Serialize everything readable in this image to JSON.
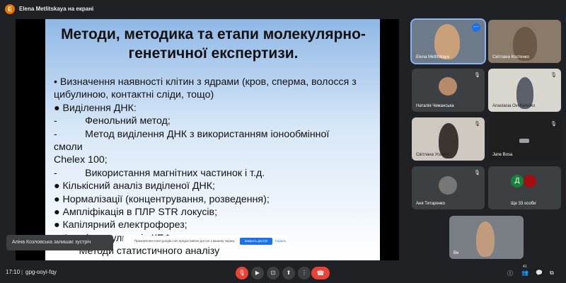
{
  "top_bar": {
    "presenter_initial": "E",
    "presenter_label": "Elena Metlitskaya на екрані"
  },
  "slide": {
    "title_lines": [
      "Методи, методика та етапи молекулярно-",
      "генетичної експертизи."
    ],
    "body_lines": [
      "• Визначення наявності клітин з ядрами (кров, сперма, волосся з",
      "цибулиною, контактні сліди, тощо)",
      "● Виділення ДНК:",
      "-          Фенольний метод;",
      "-          Метод виділення ДНК з використанням іонообмінної",
      "смоли",
      "Chelex 100;",
      "-          Використання магнітних частинок і т.д.",
      "●  Кількісний аналіз виділеної ДНК;",
      "● Нормалізації (концентрування, розведення);",
      "● Ампліфікація в ПЛР STR локусів;",
      "● Капілярний електрофорез;",
      "● Аналіз результатів КЕФа",
      "         Методи статистичного аналізу"
    ]
  },
  "participants": [
    {
      "name": "Elena Metlitskaya"
    },
    {
      "name": "Світлана Костенко"
    },
    {
      "name": "Наталія Чижанська"
    },
    {
      "name": "Anastasia Ovcharenko"
    },
    {
      "name": "Світлана Усенко"
    },
    {
      "name": "Jane Bosa"
    },
    {
      "name": "Аня Титаренко"
    },
    {
      "name": "Ще 33 особи",
      "avatar_letter": "Д"
    },
    {
      "name": "Ви"
    }
  ],
  "toast": {
    "text": "Аліна Козловська залишає зустріч"
  },
  "share_notice": {
    "text": "Призначення meet.google.com предоставлен доступ к вашему экрану.",
    "allow_label": "Закрыть доступ",
    "dismiss_label": "Скрыть"
  },
  "bottom_bar": {
    "time": "17:10",
    "separator": "|",
    "meeting_code": "gpg-ooyi-fqy",
    "participant_count": "41"
  },
  "icons": {
    "mic": "mic-off-icon",
    "cam": "videocam-icon",
    "cc": "captions-icon",
    "present": "present-icon",
    "more": "more-vert-icon",
    "hangup": "call-end-icon"
  },
  "colors": {
    "background": "#202124",
    "accent": "#1a73e8",
    "danger": "#ea4335"
  }
}
